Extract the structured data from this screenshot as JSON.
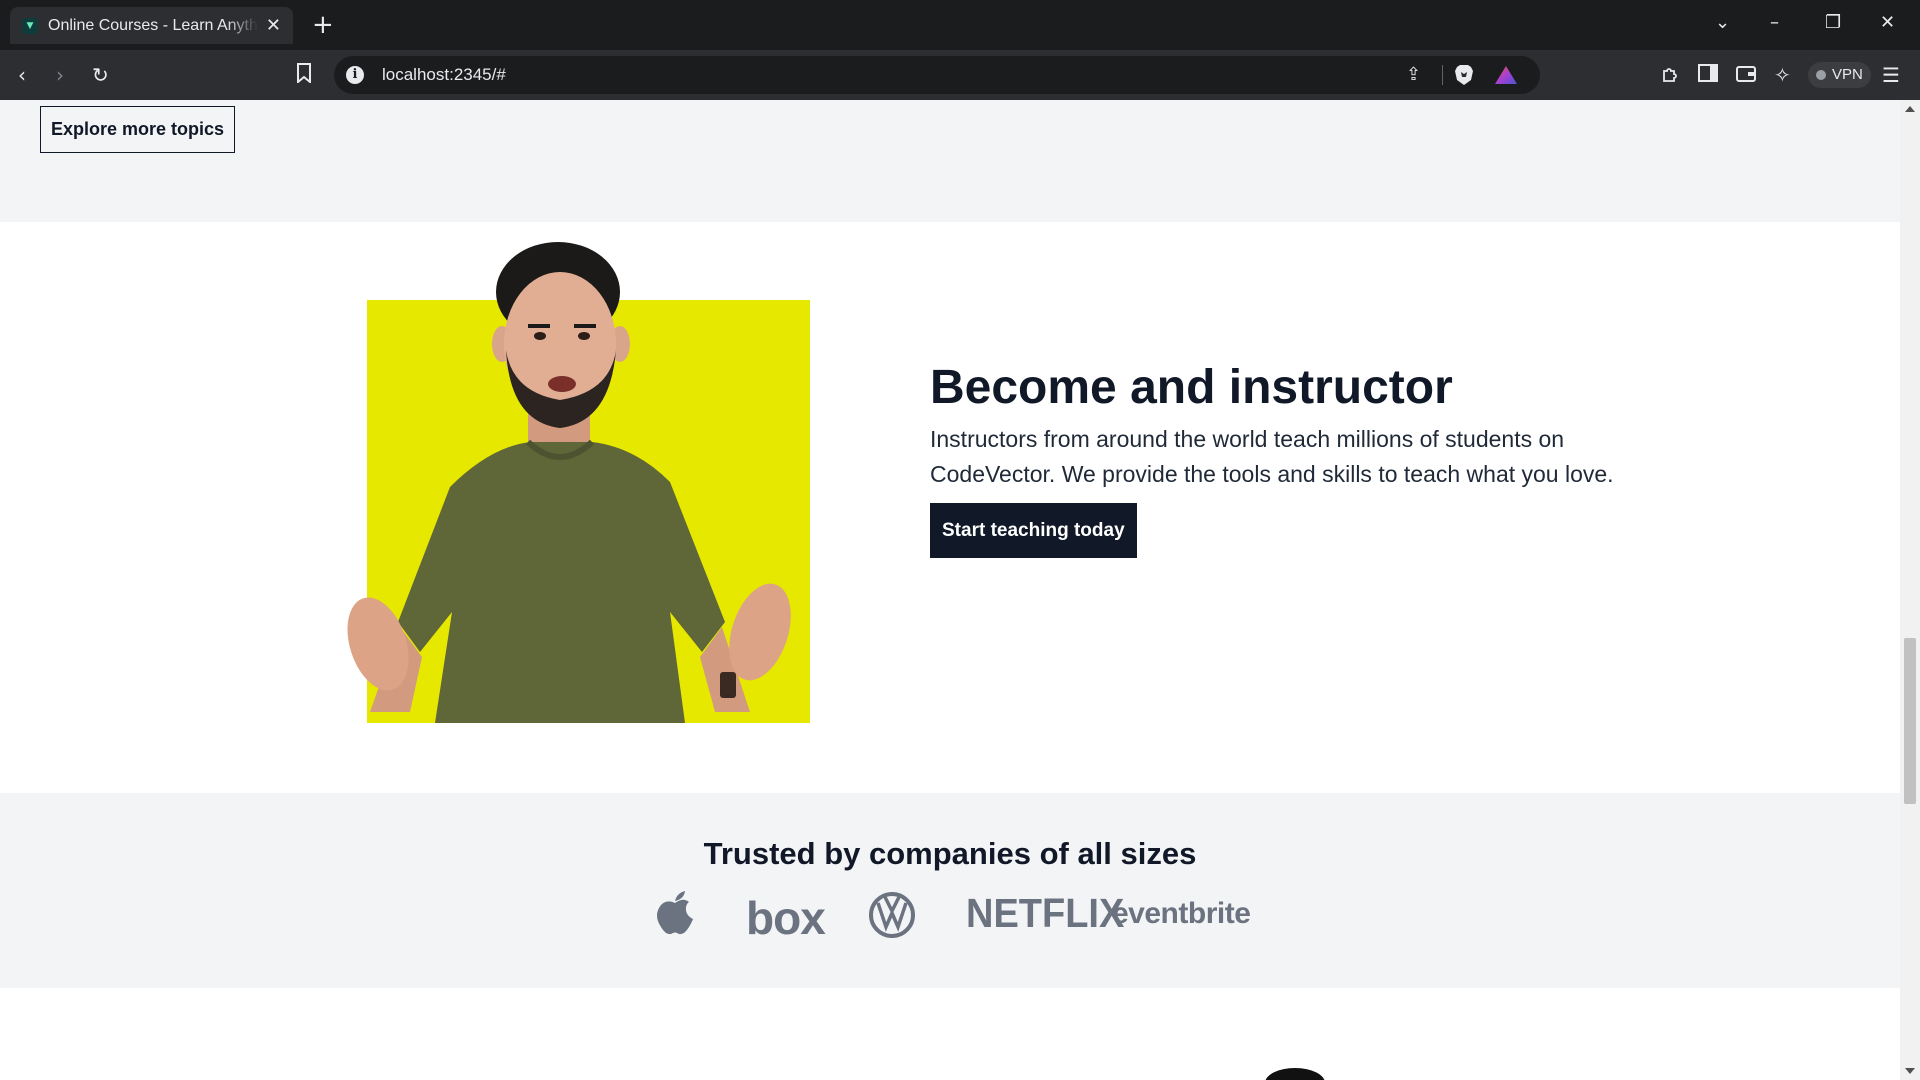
{
  "browser": {
    "tab_title": "Online Courses - Learn Anything",
    "url": "localhost:2345/#",
    "vpn_label": "VPN",
    "accent": "#fb542b"
  },
  "page": {
    "topics_button": "Explore more topics",
    "instructor": {
      "title": "Become and instructor",
      "description": "Instructors from around the world teach millions of students on CodeVector. We provide the tools and skills to teach what you love.",
      "cta": "Start teaching today",
      "highlight_color": "#e7e800"
    },
    "trusted": {
      "title": "Trusted by companies of all sizes",
      "logos": [
        {
          "name": "apple",
          "text": ""
        },
        {
          "name": "box",
          "text": "box"
        },
        {
          "name": "volkswagen",
          "text": ""
        },
        {
          "name": "netflix",
          "text": "NETFLIX"
        },
        {
          "name": "eventbrite",
          "text": "eventbrite"
        }
      ]
    }
  }
}
